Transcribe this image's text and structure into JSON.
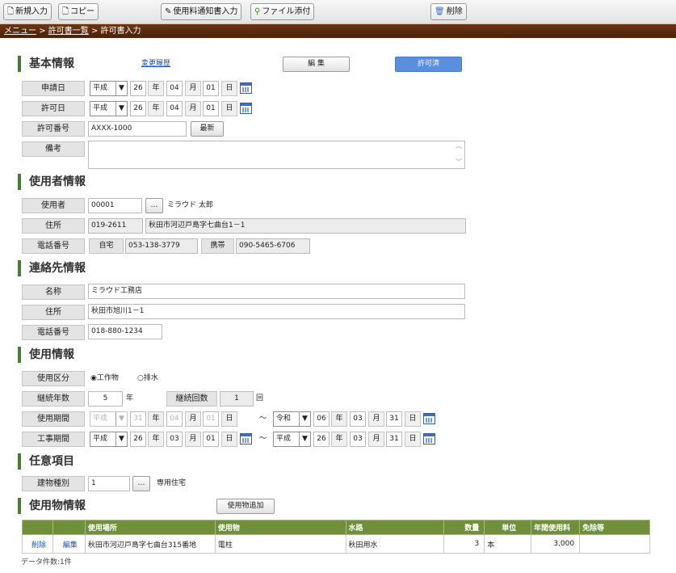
{
  "toolbar": {
    "new_label": "新規入力",
    "copy_label": "コピー",
    "fee_notice_label": "使用料通知書入力",
    "attach_label": "ファイル添付",
    "delete_label": "削除"
  },
  "breadcrumb": {
    "menu": "メニュー",
    "sep1": ">",
    "list": "許可書一覧",
    "sep2": ">",
    "current": "許可書入力"
  },
  "basic": {
    "title": "基本情報",
    "history_link": "変更履歴",
    "edit_label": "編 集",
    "status_label": "許可済",
    "status_color": "#5a8fe0",
    "apply_date": {
      "label": "申請日",
      "era": "平成",
      "year": "26",
      "month": "04",
      "day": "01"
    },
    "permit_date": {
      "label": "許可日",
      "era": "平成",
      "year": "26",
      "month": "04",
      "day": "01"
    },
    "permit_no": {
      "label": "許可番号",
      "value": "AXXX-1000",
      "latest_label": "最新"
    },
    "remarks": {
      "label": "備考",
      "value": ""
    },
    "u_year": "年",
    "u_month": "月",
    "u_day": "日"
  },
  "user": {
    "title": "使用者情報",
    "user_label": "使用者",
    "user_code": "00001",
    "user_name": "ミラウド 太郎",
    "address_label": "住所",
    "postal": "019-2611",
    "address": "秋田市河辺戸島字七曲台1－1",
    "phone_label": "電話番号",
    "home_label": "自宅",
    "home_phone": "053-138-3779",
    "mobile_label": "携帯",
    "mobile_phone": "090-5465-6706"
  },
  "contact": {
    "title": "連絡先情報",
    "name_label": "名称",
    "name": "ミラウド工務店",
    "address_label": "住所",
    "address": "秋田市旭川1－1",
    "phone_label": "電話番号",
    "phone": "018-880-1234"
  },
  "usage": {
    "title": "使用情報",
    "type_label": "使用区分",
    "opt1": "工作物",
    "opt2": "排水",
    "cont_years_label": "継続年数",
    "cont_years": "5",
    "years_unit": "年",
    "cont_count_label": "継続回数",
    "cont_count": "1",
    "count_unit": "回",
    "period_label": "使用期間",
    "period_from": {
      "era": "平成",
      "year": "31",
      "month": "04",
      "day": "01"
    },
    "tilde": "～",
    "period_to": {
      "era": "令和",
      "year": "06",
      "month": "03",
      "day": "31"
    },
    "work_label": "工事期間",
    "work_from": {
      "era": "平成",
      "year": "26",
      "month": "03",
      "day": "01"
    },
    "work_to": {
      "era": "平成",
      "year": "26",
      "month": "03",
      "day": "31"
    }
  },
  "optional": {
    "title": "任意項目",
    "building_label": "建物種別",
    "building_code": "1",
    "building_name": "専用住宅"
  },
  "objects": {
    "title": "使用物情報",
    "add_label": "使用物追加",
    "columns": [
      "",
      "",
      "使用場所",
      "使用物",
      "水路",
      "数量",
      "単位",
      "年間使用料",
      "免除等"
    ],
    "rows": [
      {
        "del": "削除",
        "edit": "編集",
        "place": "秋田市河辺戸島字七曲台315番地",
        "item": "電柱",
        "waterway": "秋田用水",
        "qty": "3",
        "unit": "本",
        "fee": "3,000",
        "exempt": ""
      }
    ],
    "count_text": "データ件数:1件",
    "header_color": "#6f8f3a"
  },
  "ellipsis": "…"
}
